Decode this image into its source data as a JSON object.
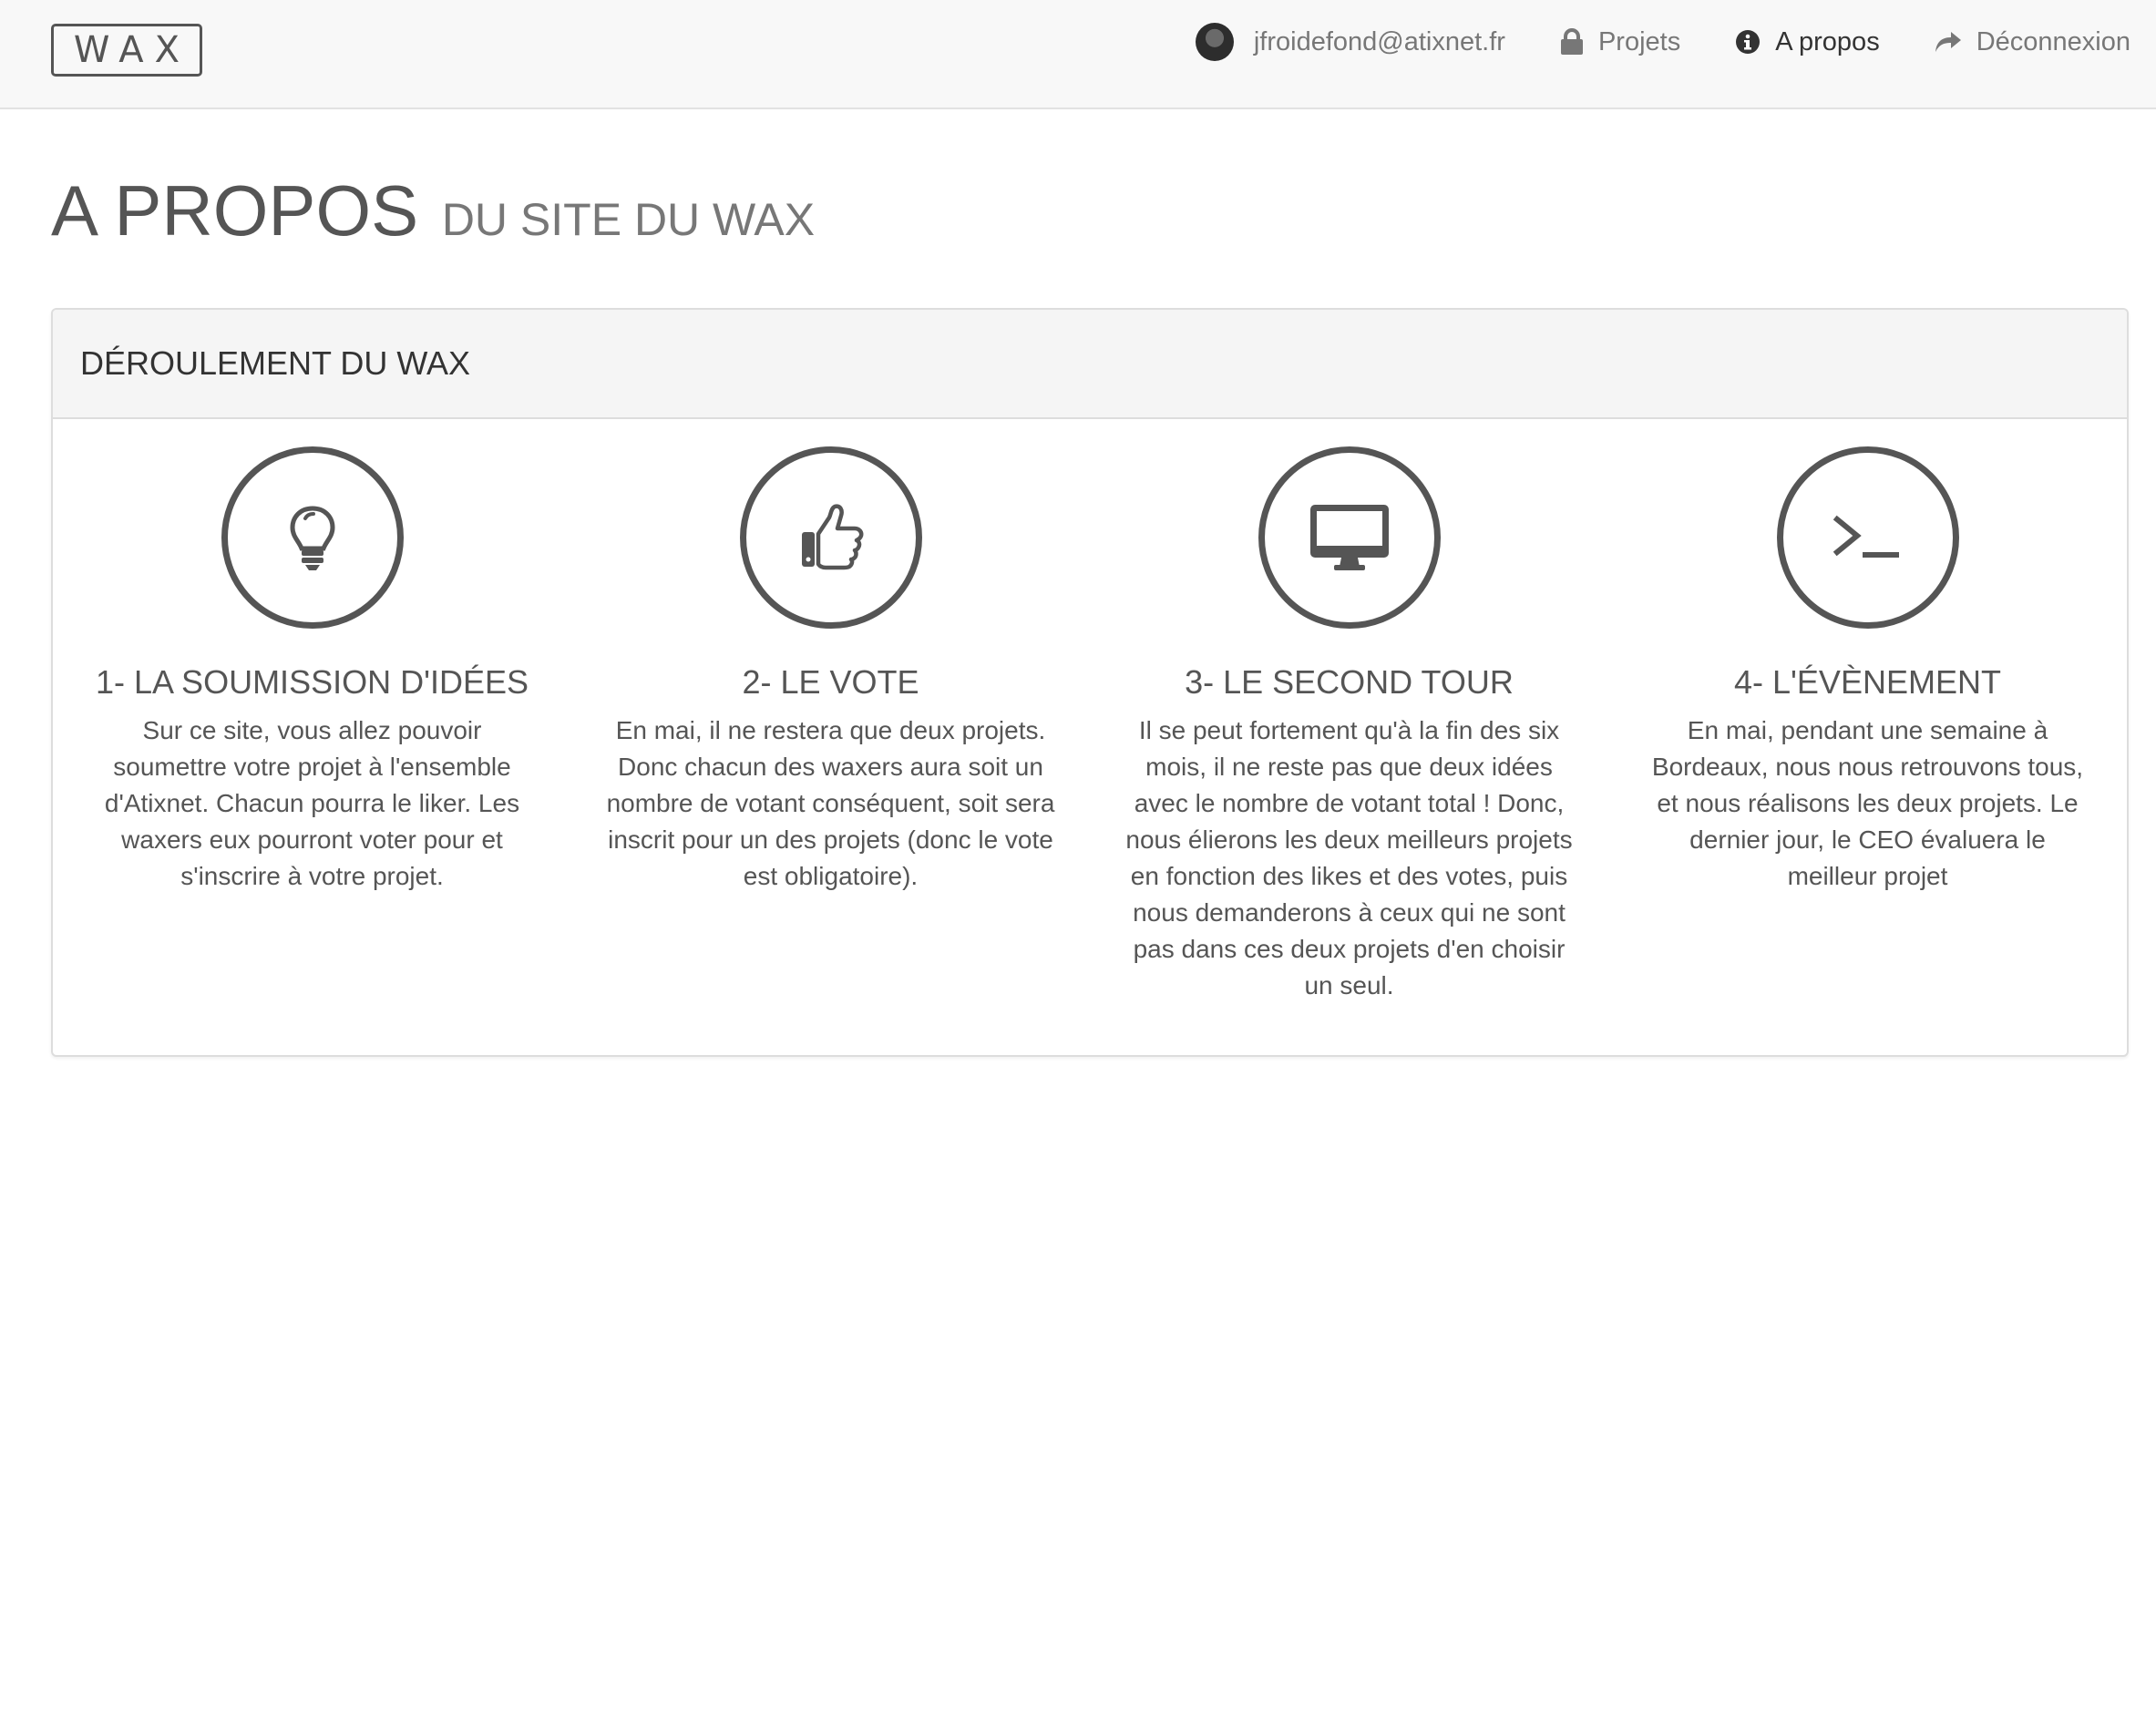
{
  "navbar": {
    "brand": "WAX",
    "items": [
      {
        "label": "jfroidefond@atixnet.fr",
        "icon": "avatar"
      },
      {
        "label": "Projets",
        "icon": "lock-icon"
      },
      {
        "label": "A propos",
        "icon": "info-icon"
      },
      {
        "label": "Déconnexion",
        "icon": "share-arrow-icon"
      }
    ]
  },
  "header": {
    "title": "A PROPOS",
    "subtitle": "DU SITE DU WAX"
  },
  "panel": {
    "heading": "DÉROULEMENT DU WAX",
    "steps": [
      {
        "icon": "lightbulb-icon",
        "title": "1- LA SOUMISSION D'IDÉES",
        "text": "Sur ce site, vous allez pouvoir soumettre votre projet à l'ensemble d'Atixnet. Chacun pourra le liker. Les waxers eux pourront voter pour et s'inscrire à votre projet."
      },
      {
        "icon": "thumbs-up-icon",
        "title": "2- LE VOTE",
        "text": "En mai, il ne restera que deux projets. Donc chacun des waxers aura soit un nombre de votant conséquent, soit sera inscrit pour un des projets (donc le vote est obligatoire)."
      },
      {
        "icon": "desktop-icon",
        "title": "3- LE SECOND TOUR",
        "text": "Il se peut fortement qu'à la fin des six mois, il ne reste pas que deux idées avec le nombre de votant total ! Donc, nous élierons les deux meilleurs projets en fonction des likes et des votes, puis nous demanderons à ceux qui ne sont pas dans ces deux projets d'en choisir un seul."
      },
      {
        "icon": "terminal-icon",
        "title": "4- L'ÉVÈNEMENT",
        "text": "En mai, pendant une semaine à Bordeaux, nous nous retrouvons tous, et nous réalisons les deux projets. Le dernier jour, le CEO évaluera le meilleur projet"
      }
    ]
  }
}
